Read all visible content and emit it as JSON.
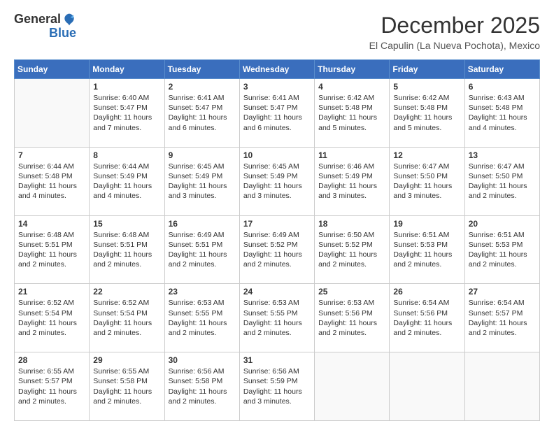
{
  "logo": {
    "general": "General",
    "blue": "Blue"
  },
  "header": {
    "month": "December 2025",
    "location": "El Capulin (La Nueva Pochota), Mexico"
  },
  "days": [
    "Sunday",
    "Monday",
    "Tuesday",
    "Wednesday",
    "Thursday",
    "Friday",
    "Saturday"
  ],
  "weeks": [
    [
      {
        "num": "",
        "lines": []
      },
      {
        "num": "1",
        "lines": [
          "Sunrise: 6:40 AM",
          "Sunset: 5:47 PM",
          "Daylight: 11 hours",
          "and 7 minutes."
        ]
      },
      {
        "num": "2",
        "lines": [
          "Sunrise: 6:41 AM",
          "Sunset: 5:47 PM",
          "Daylight: 11 hours",
          "and 6 minutes."
        ]
      },
      {
        "num": "3",
        "lines": [
          "Sunrise: 6:41 AM",
          "Sunset: 5:47 PM",
          "Daylight: 11 hours",
          "and 6 minutes."
        ]
      },
      {
        "num": "4",
        "lines": [
          "Sunrise: 6:42 AM",
          "Sunset: 5:48 PM",
          "Daylight: 11 hours",
          "and 5 minutes."
        ]
      },
      {
        "num": "5",
        "lines": [
          "Sunrise: 6:42 AM",
          "Sunset: 5:48 PM",
          "Daylight: 11 hours",
          "and 5 minutes."
        ]
      },
      {
        "num": "6",
        "lines": [
          "Sunrise: 6:43 AM",
          "Sunset: 5:48 PM",
          "Daylight: 11 hours",
          "and 4 minutes."
        ]
      }
    ],
    [
      {
        "num": "7",
        "lines": [
          "Sunrise: 6:44 AM",
          "Sunset: 5:48 PM",
          "Daylight: 11 hours",
          "and 4 minutes."
        ]
      },
      {
        "num": "8",
        "lines": [
          "Sunrise: 6:44 AM",
          "Sunset: 5:49 PM",
          "Daylight: 11 hours",
          "and 4 minutes."
        ]
      },
      {
        "num": "9",
        "lines": [
          "Sunrise: 6:45 AM",
          "Sunset: 5:49 PM",
          "Daylight: 11 hours",
          "and 3 minutes."
        ]
      },
      {
        "num": "10",
        "lines": [
          "Sunrise: 6:45 AM",
          "Sunset: 5:49 PM",
          "Daylight: 11 hours",
          "and 3 minutes."
        ]
      },
      {
        "num": "11",
        "lines": [
          "Sunrise: 6:46 AM",
          "Sunset: 5:49 PM",
          "Daylight: 11 hours",
          "and 3 minutes."
        ]
      },
      {
        "num": "12",
        "lines": [
          "Sunrise: 6:47 AM",
          "Sunset: 5:50 PM",
          "Daylight: 11 hours",
          "and 3 minutes."
        ]
      },
      {
        "num": "13",
        "lines": [
          "Sunrise: 6:47 AM",
          "Sunset: 5:50 PM",
          "Daylight: 11 hours",
          "and 2 minutes."
        ]
      }
    ],
    [
      {
        "num": "14",
        "lines": [
          "Sunrise: 6:48 AM",
          "Sunset: 5:51 PM",
          "Daylight: 11 hours",
          "and 2 minutes."
        ]
      },
      {
        "num": "15",
        "lines": [
          "Sunrise: 6:48 AM",
          "Sunset: 5:51 PM",
          "Daylight: 11 hours",
          "and 2 minutes."
        ]
      },
      {
        "num": "16",
        "lines": [
          "Sunrise: 6:49 AM",
          "Sunset: 5:51 PM",
          "Daylight: 11 hours",
          "and 2 minutes."
        ]
      },
      {
        "num": "17",
        "lines": [
          "Sunrise: 6:49 AM",
          "Sunset: 5:52 PM",
          "Daylight: 11 hours",
          "and 2 minutes."
        ]
      },
      {
        "num": "18",
        "lines": [
          "Sunrise: 6:50 AM",
          "Sunset: 5:52 PM",
          "Daylight: 11 hours",
          "and 2 minutes."
        ]
      },
      {
        "num": "19",
        "lines": [
          "Sunrise: 6:51 AM",
          "Sunset: 5:53 PM",
          "Daylight: 11 hours",
          "and 2 minutes."
        ]
      },
      {
        "num": "20",
        "lines": [
          "Sunrise: 6:51 AM",
          "Sunset: 5:53 PM",
          "Daylight: 11 hours",
          "and 2 minutes."
        ]
      }
    ],
    [
      {
        "num": "21",
        "lines": [
          "Sunrise: 6:52 AM",
          "Sunset: 5:54 PM",
          "Daylight: 11 hours",
          "and 2 minutes."
        ]
      },
      {
        "num": "22",
        "lines": [
          "Sunrise: 6:52 AM",
          "Sunset: 5:54 PM",
          "Daylight: 11 hours",
          "and 2 minutes."
        ]
      },
      {
        "num": "23",
        "lines": [
          "Sunrise: 6:53 AM",
          "Sunset: 5:55 PM",
          "Daylight: 11 hours",
          "and 2 minutes."
        ]
      },
      {
        "num": "24",
        "lines": [
          "Sunrise: 6:53 AM",
          "Sunset: 5:55 PM",
          "Daylight: 11 hours",
          "and 2 minutes."
        ]
      },
      {
        "num": "25",
        "lines": [
          "Sunrise: 6:53 AM",
          "Sunset: 5:56 PM",
          "Daylight: 11 hours",
          "and 2 minutes."
        ]
      },
      {
        "num": "26",
        "lines": [
          "Sunrise: 6:54 AM",
          "Sunset: 5:56 PM",
          "Daylight: 11 hours",
          "and 2 minutes."
        ]
      },
      {
        "num": "27",
        "lines": [
          "Sunrise: 6:54 AM",
          "Sunset: 5:57 PM",
          "Daylight: 11 hours",
          "and 2 minutes."
        ]
      }
    ],
    [
      {
        "num": "28",
        "lines": [
          "Sunrise: 6:55 AM",
          "Sunset: 5:57 PM",
          "Daylight: 11 hours",
          "and 2 minutes."
        ]
      },
      {
        "num": "29",
        "lines": [
          "Sunrise: 6:55 AM",
          "Sunset: 5:58 PM",
          "Daylight: 11 hours",
          "and 2 minutes."
        ]
      },
      {
        "num": "30",
        "lines": [
          "Sunrise: 6:56 AM",
          "Sunset: 5:58 PM",
          "Daylight: 11 hours",
          "and 2 minutes."
        ]
      },
      {
        "num": "31",
        "lines": [
          "Sunrise: 6:56 AM",
          "Sunset: 5:59 PM",
          "Daylight: 11 hours",
          "and 3 minutes."
        ]
      },
      {
        "num": "",
        "lines": []
      },
      {
        "num": "",
        "lines": []
      },
      {
        "num": "",
        "lines": []
      }
    ]
  ]
}
